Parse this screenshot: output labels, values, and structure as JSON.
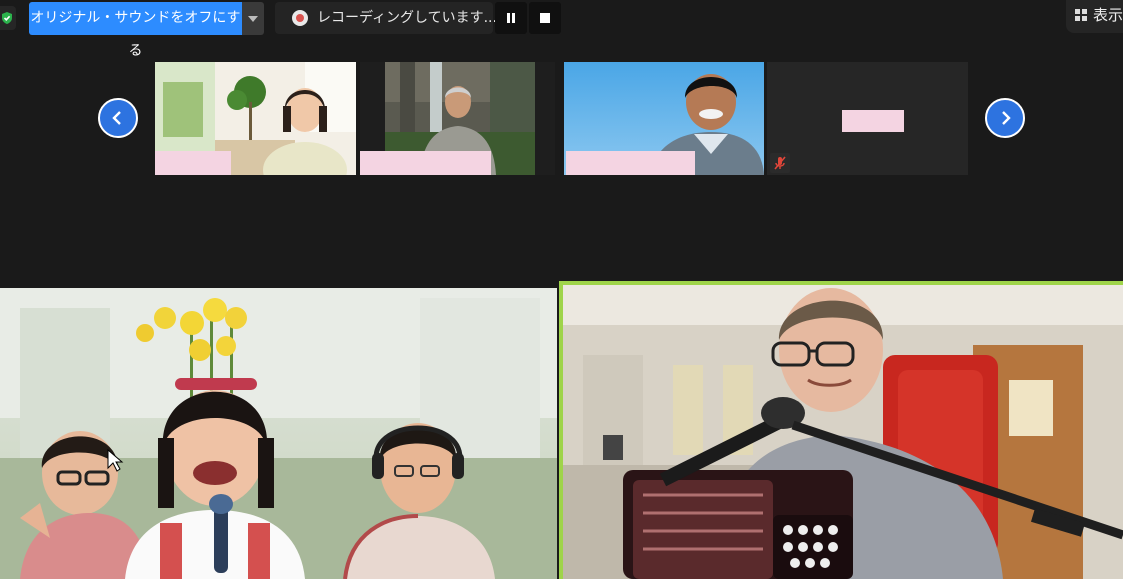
{
  "toolbar": {
    "sound_button_label": "オリジナル・サウンドをオフにする",
    "recording_status": "レコーディングしています...",
    "view_label": "表示"
  },
  "participants": [
    {
      "tile": "thumbnail-1",
      "name": "",
      "muted": false
    },
    {
      "tile": "thumbnail-2",
      "name": "",
      "muted": false
    },
    {
      "tile": "thumbnail-3",
      "name": "",
      "muted": false
    },
    {
      "tile": "thumbnail-4",
      "name": "",
      "muted": true,
      "video_off": true
    }
  ],
  "colors": {
    "accent": "#2d8cff",
    "nav_button": "#2d73e0",
    "active_speaker_border": "#9fd44a",
    "name_redaction": "#f4d4e2",
    "background": "#1a1a1a"
  }
}
